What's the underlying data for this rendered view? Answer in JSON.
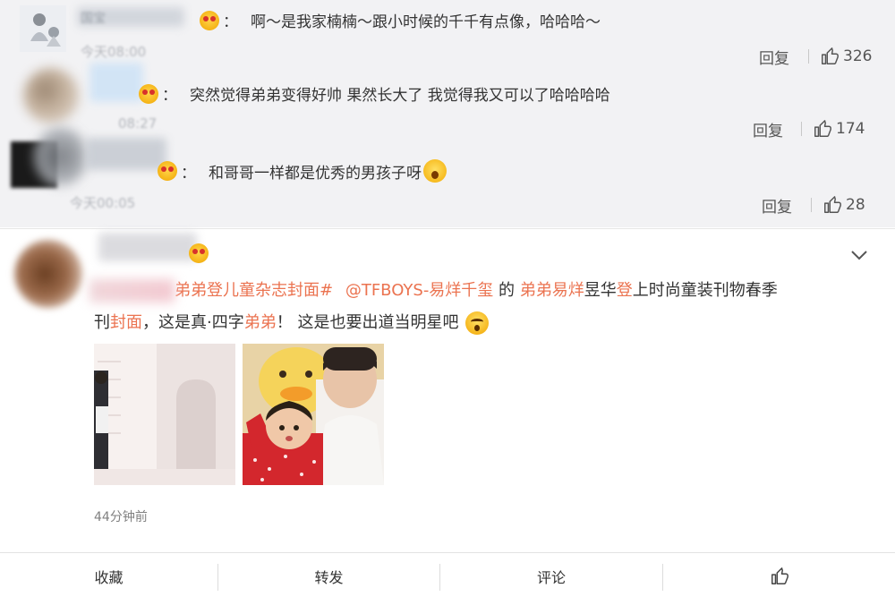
{
  "comments": [
    {
      "name": "国宝",
      "time": "今天08:00",
      "text": "啊～是我家楠楠～跟小时候的千千有点像，哈哈哈～",
      "reply_label": "回复",
      "likes": "326"
    },
    {
      "name": "",
      "time": "08:27",
      "text": "突然觉得弟弟变得好帅 果然长大了 我觉得我又可以了哈哈哈哈",
      "reply_label": "回复",
      "likes": "174"
    },
    {
      "name": "",
      "time": "今天00:05",
      "text": "和哥哥一样都是优秀的男孩子呀",
      "reply_label": "回复",
      "likes": "28"
    }
  ],
  "post": {
    "line1": {
      "hashtag": "弟弟登儿童杂志封面#",
      "mention": "@TFBOYS-易烊千玺",
      "de": " 的",
      "brother_name": "弟弟易烊",
      "yu_hua": "昱华",
      "deng": "登",
      "tail": "上时尚童装刊物春季"
    },
    "line2": {
      "kan": "刊",
      "cover": "封面",
      "mid": "，这是真·四字",
      "brother": "弟弟",
      "tail": "！ 这是也要出道当明星吧"
    },
    "time": "44分钟前"
  },
  "toolbar": {
    "collect": "收藏",
    "repost": "转发",
    "comment": "评论"
  },
  "icons": {
    "like": "thumbs-up-icon",
    "chevron": "chevron-down-icon",
    "emoji_red_eyes": "heart-eyes-emoji-icon",
    "emoji_shock": "shocked-emoji-icon",
    "emoji_wow": "surprised-emoji-icon"
  },
  "colors": {
    "highlight": "#eb7350",
    "comment_bg": "#f2f2f4"
  }
}
